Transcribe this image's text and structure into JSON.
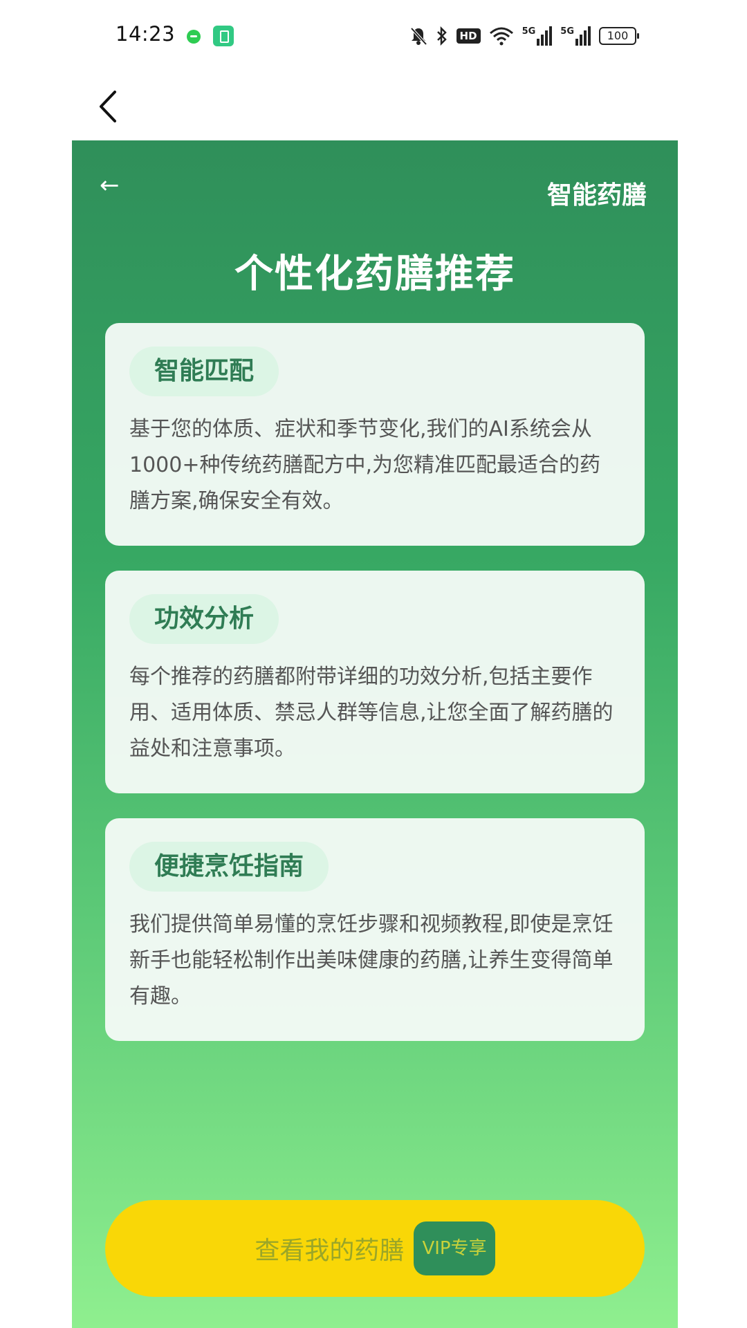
{
  "status_bar": {
    "time": "14:23",
    "icons": [
      "chat-notification-icon",
      "battery-saver-app-icon",
      "mute-icon",
      "bluetooth-icon",
      "hd-icon",
      "wifi-icon",
      "signal-5g-icon",
      "signal-5g-icon",
      "battery-icon"
    ],
    "hd_label": "HD",
    "net_label": "5G",
    "battery_level": "100"
  },
  "nav": {
    "back_icon": "chevron-left-icon"
  },
  "app": {
    "back_arrow": "←",
    "label": "智能药膳",
    "title": "个性化药膳推荐",
    "colors": {
      "gradient_top": "#2f8f5a",
      "gradient_bottom": "#8fef8f",
      "tag_bg": "#dcf5e5",
      "tag_text": "#2f7c54",
      "cta_bg": "#f9d707"
    }
  },
  "cards": [
    {
      "tag": "智能匹配",
      "body": "基于您的体质、症状和季节变化,我们的AI系统会从1000+种传统药膳配方中,为您精准匹配最适合的药膳方案,确保安全有效。"
    },
    {
      "tag": "功效分析",
      "body": "每个推荐的药膳都附带详细的功效分析,包括主要作用、适用体质、禁忌人群等信息,让您全面了解药膳的益处和注意事项。"
    },
    {
      "tag": "便捷烹饪指南",
      "body": "我们提供简单易懂的烹饪步骤和视频教程,即使是烹饪新手也能轻松制作出美味健康的药膳,让养生变得简单有趣。"
    }
  ],
  "cta": {
    "label": "查看我的药膳",
    "badge": "VIP专享"
  }
}
